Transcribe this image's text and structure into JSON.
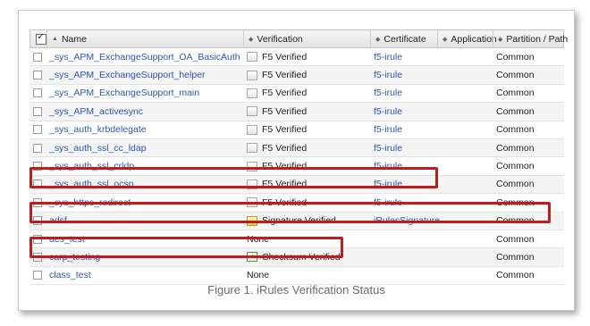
{
  "table": {
    "headers": {
      "name": "Name",
      "verification": "Verification",
      "certificate": "Certificate",
      "application": "Application",
      "partition": "Partition / Path"
    },
    "rows": [
      {
        "name": "_sys_APM_ExchangeSupport_OA_BasicAuth",
        "verification": "F5 Verified",
        "verification_icon": "document-verified-icon",
        "certificate": "f5-irule",
        "application": "",
        "partition": "Common"
      },
      {
        "name": "_sys_APM_ExchangeSupport_helper",
        "verification": "F5 Verified",
        "verification_icon": "document-verified-icon",
        "certificate": "f5-irule",
        "application": "",
        "partition": "Common"
      },
      {
        "name": "_sys_APM_ExchangeSupport_main",
        "verification": "F5 Verified",
        "verification_icon": "document-verified-icon",
        "certificate": "f5-irule",
        "application": "",
        "partition": "Common"
      },
      {
        "name": "_sys_APM_activesync",
        "verification": "F5 Verified",
        "verification_icon": "document-verified-icon",
        "certificate": "f5-irule",
        "application": "",
        "partition": "Common"
      },
      {
        "name": "_sys_auth_krbdelegate",
        "verification": "F5 Verified",
        "verification_icon": "document-verified-icon",
        "certificate": "f5-irule",
        "application": "",
        "partition": "Common"
      },
      {
        "name": "_sys_auth_ssl_cc_ldap",
        "verification": "F5 Verified",
        "verification_icon": "document-verified-icon",
        "certificate": "f5-irule",
        "application": "",
        "partition": "Common"
      },
      {
        "name": "_sys_auth_ssl_crldp",
        "verification": "F5 Verified",
        "verification_icon": "document-verified-icon",
        "certificate": "f5-irule",
        "application": "",
        "partition": "Common"
      },
      {
        "name": "_sys_auth_ssl_ocsp",
        "verification": "F5 Verified",
        "verification_icon": "document-verified-icon",
        "certificate": "f5-irule",
        "application": "",
        "partition": "Common"
      },
      {
        "name": "_sys_https_redirect",
        "verification": "F5 Verified",
        "verification_icon": "document-verified-icon",
        "certificate": "f5-irule",
        "application": "",
        "partition": "Common"
      },
      {
        "name": "adsf",
        "verification": "Signature Verified",
        "verification_icon": "signature-icon",
        "certificate": "iRulesSignature",
        "application": "",
        "partition": "Common"
      },
      {
        "name": "aes_test",
        "verification": "None",
        "verification_icon": "",
        "certificate": "",
        "application": "",
        "partition": "Common"
      },
      {
        "name": "carp_testing",
        "verification": "Checksum Verified",
        "verification_icon": "checksum-icon",
        "certificate": "",
        "application": "",
        "partition": "Common"
      },
      {
        "name": "class_test",
        "verification": "None",
        "verification_icon": "",
        "certificate": "",
        "application": "",
        "partition": "Common"
      }
    ]
  },
  "caption": "Figure 1. iRules Verification Status",
  "colors": {
    "link": "#2a56b0",
    "highlight": "#c41a1a",
    "header_bg": "#e8e8e8"
  }
}
